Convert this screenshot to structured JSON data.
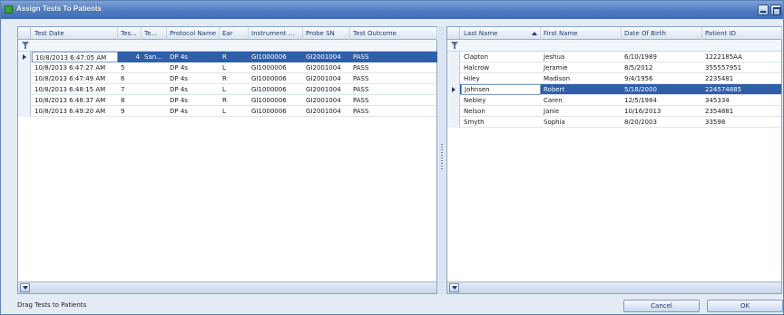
{
  "window": {
    "title": "Assign Tests To Patients"
  },
  "tests": {
    "columns": [
      "Test Date",
      "Tes...",
      "Te...",
      "Protocol Name",
      "Ear",
      "Instrument ...",
      "Probe SN",
      "Test Outcome"
    ],
    "rows": [
      [
        "10/8/2013 6:47:05 AM",
        "4",
        "San...",
        "DP 4s",
        "R",
        "GI1000006",
        "GI2001004",
        "PASS"
      ],
      [
        "10/8/2013 6:47:27 AM",
        "5",
        "",
        "DP 4s",
        "L",
        "GI1000006",
        "GI2001004",
        "PASS"
      ],
      [
        "10/8/2013 6:47:49 AM",
        "6",
        "",
        "DP 4s",
        "R",
        "GI1000006",
        "GI2001004",
        "PASS"
      ],
      [
        "10/8/2013 6:48:15 AM",
        "7",
        "",
        "DP 4s",
        "L",
        "GI1000006",
        "GI2001004",
        "PASS"
      ],
      [
        "10/8/2013 6:48:37 AM",
        "8",
        "",
        "DP 4s",
        "R",
        "GI1000006",
        "GI2001004",
        "PASS"
      ],
      [
        "10/8/2013 6:49:20 AM",
        "9",
        "",
        "DP 4s",
        "L",
        "GI1000006",
        "GI2001004",
        "PASS"
      ]
    ]
  },
  "patients": {
    "columns": [
      "Last Name",
      "First Name",
      "Date Of Birth",
      "Patient ID"
    ],
    "rows": [
      [
        "Clapton",
        "Jeshua",
        "6/10/1989",
        "1222185AA"
      ],
      [
        "Halcrow",
        "Jeramie",
        "8/5/2012",
        "355557951"
      ],
      [
        "Hiley",
        "Madison",
        "9/4/1956",
        "2235481"
      ],
      [
        "Johnsen",
        "Robert",
        "5/18/2000",
        "224574885"
      ],
      [
        "Nebley",
        "Caren",
        "12/5/1984",
        "345334"
      ],
      [
        "Nelson",
        "Janie",
        "10/16/2013",
        "2354881"
      ],
      [
        "Smyth",
        "Sophia",
        "8/20/2003",
        "33598"
      ]
    ]
  },
  "status": {
    "text": "Drag Tests to Patients"
  },
  "buttons": {
    "cancel": "Cancel",
    "ok": "OK"
  },
  "colors": {
    "title_bar": "#4f7bc0",
    "selection": "#2f5fa8",
    "selection_light": "#d2def0",
    "border": "#8aa3c6"
  }
}
